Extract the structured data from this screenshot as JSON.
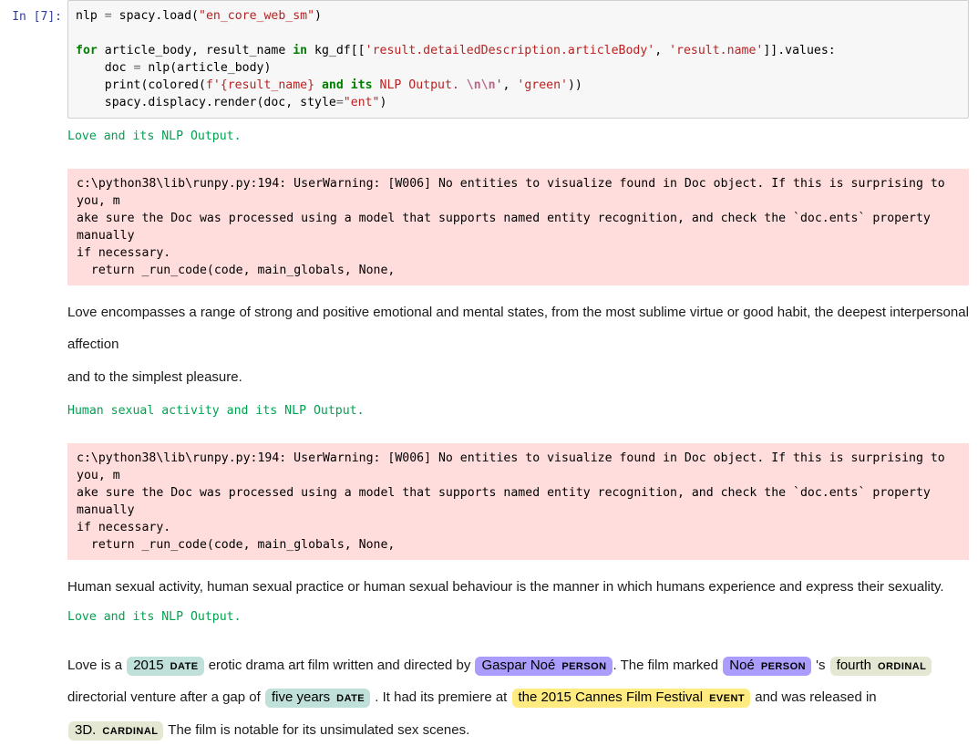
{
  "cell": {
    "prompt": "In [7]:",
    "code_lines": [
      [
        {
          "t": "nlp ",
          "c": "plain"
        },
        {
          "t": "=",
          "c": "t-op"
        },
        {
          "t": " spacy.load(",
          "c": "plain"
        },
        {
          "t": "\"en_core_web_sm\"",
          "c": "t-str"
        },
        {
          "t": ")",
          "c": "plain"
        }
      ],
      [],
      [
        {
          "t": "for",
          "c": "t-kw"
        },
        {
          "t": " article_body, result_name ",
          "c": "plain"
        },
        {
          "t": "in",
          "c": "t-kw"
        },
        {
          "t": " kg_df[[",
          "c": "plain"
        },
        {
          "t": "'result.detailedDescription.articleBody'",
          "c": "t-str"
        },
        {
          "t": ", ",
          "c": "plain"
        },
        {
          "t": "'result.name'",
          "c": "t-str"
        },
        {
          "t": "]].values:",
          "c": "plain"
        }
      ],
      [
        {
          "t": "    doc ",
          "c": "plain"
        },
        {
          "t": "=",
          "c": "t-op"
        },
        {
          "t": " nlp(article_body)",
          "c": "plain"
        }
      ],
      [
        {
          "t": "    print(colored(",
          "c": "plain"
        },
        {
          "t": "f'{result_name} ",
          "c": "t-str"
        },
        {
          "t": "and",
          "c": "t-kw"
        },
        {
          "t": " ",
          "c": "t-str"
        },
        {
          "t": "its",
          "c": "t-kw"
        },
        {
          "t": " NLP Output. ",
          "c": "t-str"
        },
        {
          "t": "\\n\\n",
          "c": "t-esc"
        },
        {
          "t": "'",
          "c": "t-str"
        },
        {
          "t": ", ",
          "c": "plain"
        },
        {
          "t": "'green'",
          "c": "t-str"
        },
        {
          "t": "))",
          "c": "plain"
        }
      ],
      [
        {
          "t": "    spacy.displacy.render(doc, style",
          "c": "plain"
        },
        {
          "t": "=",
          "c": "t-op"
        },
        {
          "t": "\"ent\"",
          "c": "t-str"
        },
        {
          "t": ")",
          "c": "plain"
        }
      ]
    ]
  },
  "outputs": {
    "green_1": "Love and its NLP Output.",
    "warning_1": "c:\\python38\\lib\\runpy.py:194: UserWarning: [W006] No entities to visualize found in Doc object. If this is surprising to you, m\nake sure the Doc was processed using a model that supports named entity recognition, and check the `doc.ents` property manually\nif necessary.\n  return _run_code(code, main_globals, None,",
    "text_1_line_a": "Love encompasses a range of strong and positive emotional and mental states, from the most sublime virtue or good habit, the deepest interpersonal affection",
    "text_1_line_b": "and to the simplest pleasure.",
    "green_2": "Human sexual activity and its NLP Output.",
    "warning_2": "c:\\python38\\lib\\runpy.py:194: UserWarning: [W006] No entities to visualize found in Doc object. If this is surprising to you, m\nake sure the Doc was processed using a model that supports named entity recognition, and check the `doc.ents` property manually\nif necessary.\n  return _run_code(code, main_globals, None,",
    "text_2": "Human sexual activity, human sexual practice or human sexual behaviour is the manner in which humans experience and express their sexuality.",
    "green_3": "Love and its NLP Output."
  },
  "entity_doc": {
    "tokens": [
      {
        "kind": "text",
        "text": "Love is a "
      },
      {
        "kind": "ent",
        "text": "2015",
        "label": "DATE"
      },
      {
        "kind": "text",
        "text": " erotic drama art film written and directed by "
      },
      {
        "kind": "ent",
        "text": "Gaspar Noé",
        "label": "PERSON"
      },
      {
        "kind": "text",
        "text": ". The film marked "
      },
      {
        "kind": "ent",
        "text": "Noé",
        "label": "PERSON"
      },
      {
        "kind": "text",
        "text": " 's "
      },
      {
        "kind": "ent",
        "text": "fourth",
        "label": "ORDINAL"
      },
      {
        "kind": "text",
        "text": " directorial venture after a gap of "
      },
      {
        "kind": "ent",
        "text": "five years",
        "label": "DATE"
      },
      {
        "kind": "text",
        "text": " . It had its premiere at "
      },
      {
        "kind": "ent",
        "text": "the 2015 Cannes Film Festival",
        "label": "EVENT"
      },
      {
        "kind": "text",
        "text": " and was released in "
      },
      {
        "kind": "ent",
        "text": "3D.",
        "label": "CARDINAL"
      },
      {
        "kind": "text",
        "text": " The film is notable for its unsimulated sex scenes."
      }
    ]
  },
  "colors": {
    "date": "#bfe1d9",
    "person": "#aa9cfc",
    "ordinal": "#e4e7d2",
    "cardinal": "#e4e7d2",
    "event": "#ffeb80",
    "stderr_bg": "#ffdddd",
    "stdout_green": "#00a250",
    "code_bg": "#f7f7f7",
    "prompt": "#303f9f"
  }
}
